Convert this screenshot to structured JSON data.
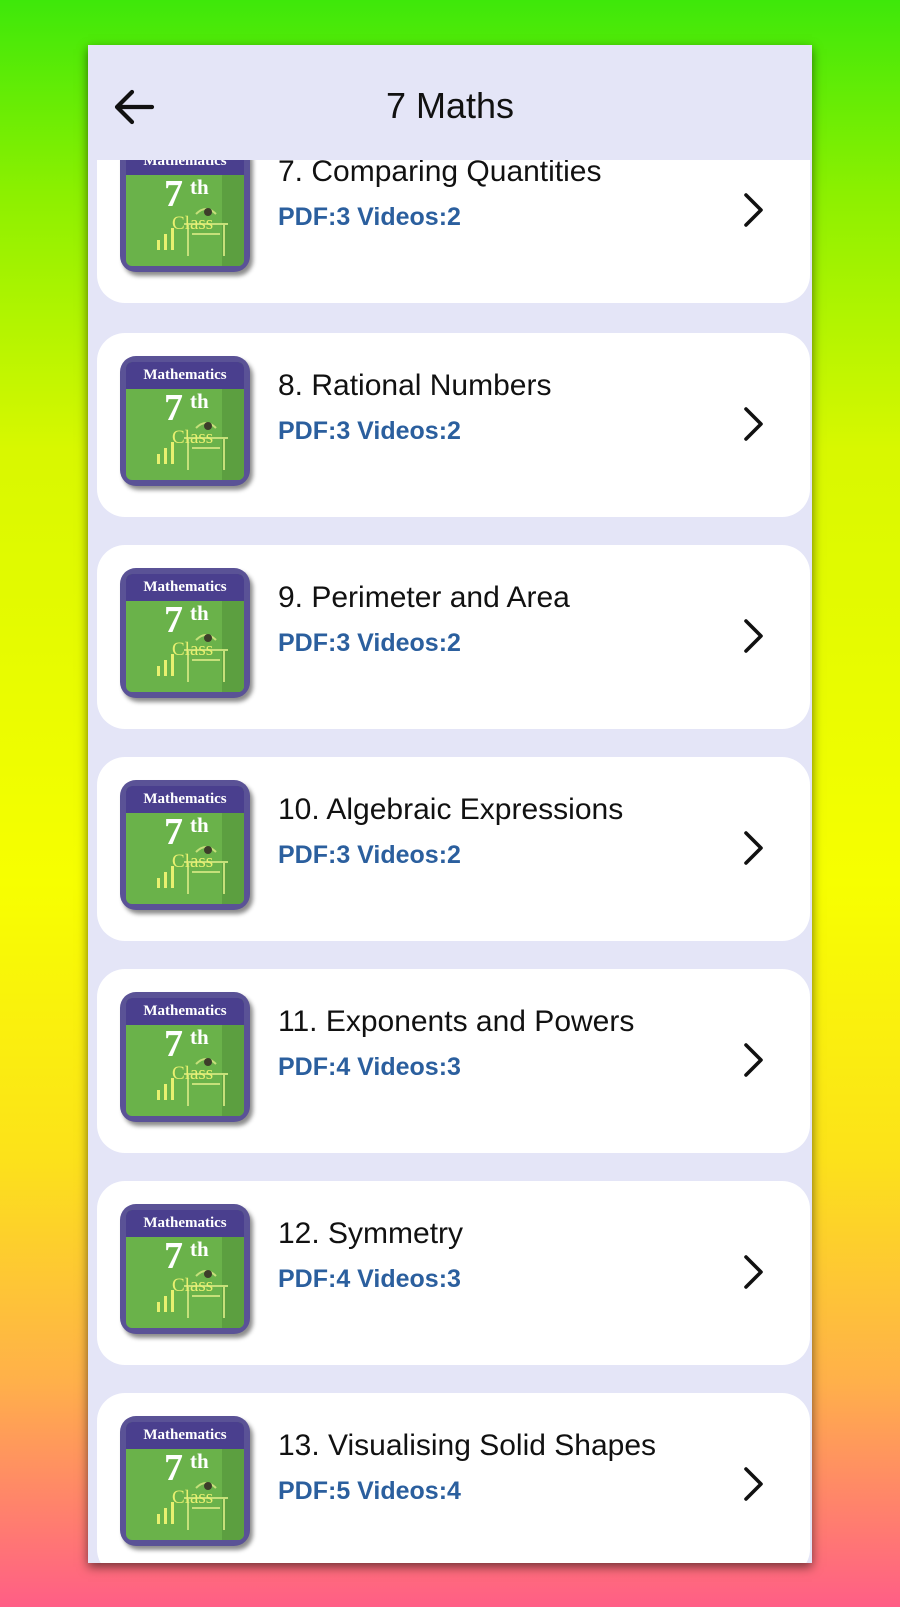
{
  "header": {
    "title": "7 Maths",
    "back_icon": "arrow-left-icon"
  },
  "thumbnail": {
    "banner": "Mathematics",
    "grade": "7",
    "grade_suffix": "th",
    "class_label": "Class"
  },
  "colors": {
    "meta_text": "#2b5f9e",
    "appbar_bg": "#e4e5f7",
    "card_bg": "#ffffff"
  },
  "chapters": [
    {
      "title": "7. Comparing Quantities",
      "meta": "PDF:3 Videos:2"
    },
    {
      "title": "8. Rational Numbers",
      "meta": "PDF:3 Videos:2"
    },
    {
      "title": "9. Perimeter and Area",
      "meta": "PDF:3 Videos:2"
    },
    {
      "title": "10. Algebraic Expressions",
      "meta": "PDF:3 Videos:2"
    },
    {
      "title": "11. Exponents and Powers",
      "meta": "PDF:4 Videos:3"
    },
    {
      "title": "12. Symmetry",
      "meta": "PDF:4 Videos:3"
    },
    {
      "title": "13. Visualising Solid Shapes",
      "meta": "PDF:5 Videos:4"
    }
  ]
}
